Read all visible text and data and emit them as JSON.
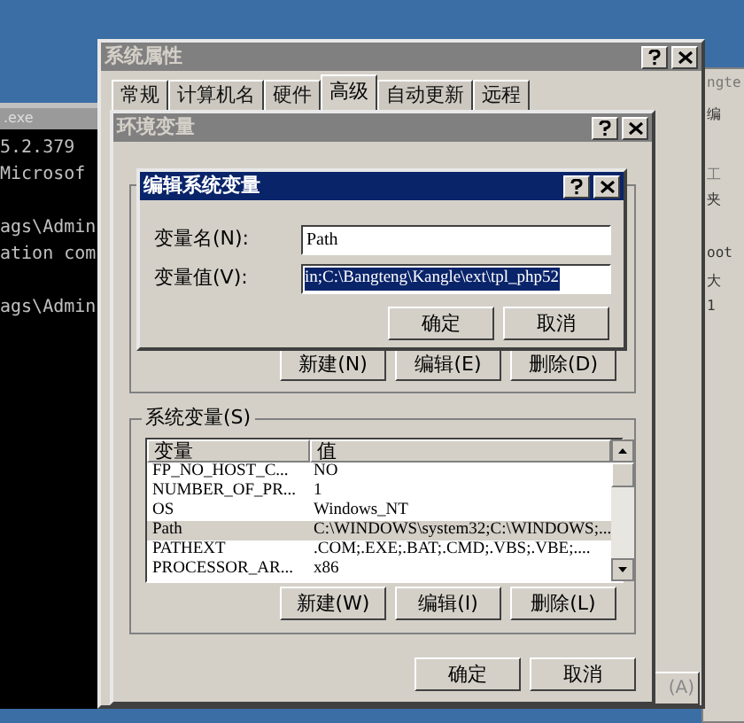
{
  "console_window": {
    "title": ".exe",
    "lines": [
      "5.2.379",
      "Microsof",
      "ags\\Admin",
      "ation com",
      "ags\\Admin"
    ]
  },
  "back_window": {
    "texts": [
      "ngte",
      "编",
      "工",
      "夹",
      "oot",
      "大",
      "1"
    ]
  },
  "system_properties": {
    "title": "系统属性",
    "tabs": [
      {
        "label": "常规",
        "selected": false
      },
      {
        "label": "计算机名",
        "selected": false
      },
      {
        "label": "硬件",
        "selected": false
      },
      {
        "label": "高级",
        "selected": true
      },
      {
        "label": "自动更新",
        "selected": false
      },
      {
        "label": "远程",
        "selected": false
      }
    ],
    "apply_button": "(A)"
  },
  "environment_variables": {
    "title": "环境变量",
    "user_buttons": [
      "新建(N)",
      "编辑(E)",
      "删除(D)"
    ],
    "system_group": "系统变量(S)",
    "columns": [
      "变量",
      "值"
    ],
    "rows": [
      {
        "name": "FP_NO_HOST_C...",
        "value": "NO",
        "selected": false
      },
      {
        "name": "NUMBER_OF_PR...",
        "value": "1",
        "selected": false
      },
      {
        "name": "OS",
        "value": "Windows_NT",
        "selected": false
      },
      {
        "name": "Path",
        "value": "C:\\WINDOWS\\system32;C:\\WINDOWS;...",
        "selected": true
      },
      {
        "name": "PATHEXT",
        "value": ".COM;.EXE;.BAT;.CMD;.VBS;.VBE;....",
        "selected": false
      },
      {
        "name": "PROCESSOR_AR...",
        "value": "x86",
        "selected": false
      }
    ],
    "system_buttons": [
      "新建(W)",
      "编辑(I)",
      "删除(L)"
    ],
    "buttons": [
      "确定",
      "取消"
    ]
  },
  "edit_dialog": {
    "title": "编辑系统变量",
    "name_label": "变量名(N):",
    "name_value": "Path",
    "value_label": "变量值(V):",
    "value_value": "in;C:\\Bangteng\\Kangle\\ext\\tpl_php52",
    "buttons": [
      "确定",
      "取消"
    ]
  }
}
